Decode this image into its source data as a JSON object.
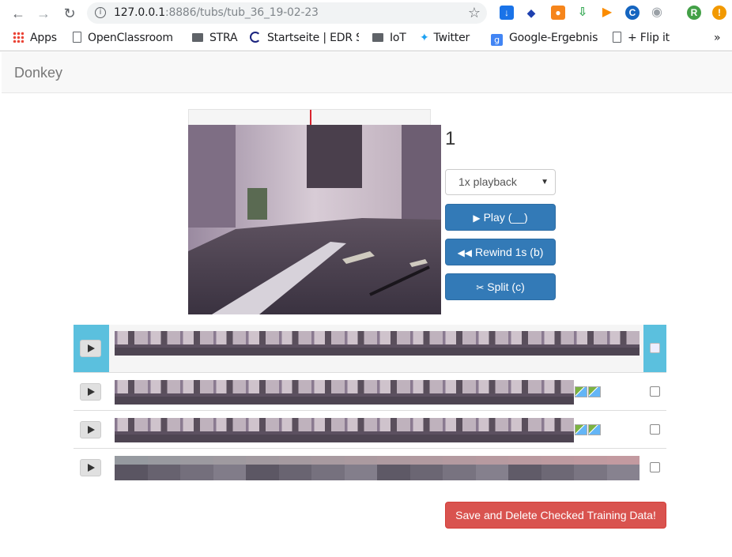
{
  "browser": {
    "url_host": "127.0.0.1",
    "url_rest": ":8886/tubs/tub_36_19-02-23",
    "bookmarks": [
      "Apps",
      "OpenClassroom",
      "STRA",
      "Startseite | EDR S",
      "IoT",
      "Twitter",
      "Google-Ergebnis",
      "+ Flip it"
    ],
    "more": "»",
    "profile_initial": "R",
    "alert": "!"
  },
  "navbar": {
    "brand": "Donkey"
  },
  "player": {
    "frame_number": "1",
    "progress_fraction": 0.5,
    "playback_select": "1x playback",
    "play_label": "Play (__)",
    "rewind_label": "Rewind 1s (b)",
    "split_label": "Split (c)"
  },
  "clips": [
    {
      "thumbnails": 16,
      "broken": 0,
      "active": true,
      "checked": false,
      "style": "indoor"
    },
    {
      "thumbnails": 14,
      "broken": 2,
      "active": false,
      "checked": false,
      "style": "indoor"
    },
    {
      "thumbnails": 14,
      "broken": 2,
      "active": false,
      "checked": false,
      "style": "indoor"
    },
    {
      "thumbnails": 16,
      "broken": 0,
      "active": false,
      "checked": false,
      "style": "track"
    }
  ],
  "actions": {
    "save_delete_label": "Save and Delete Checked Training Data!"
  },
  "colors": {
    "primary": "#337ab7",
    "danger": "#d9534f",
    "active_row": "#5bc0de",
    "progress_marker": "#d9232e"
  }
}
